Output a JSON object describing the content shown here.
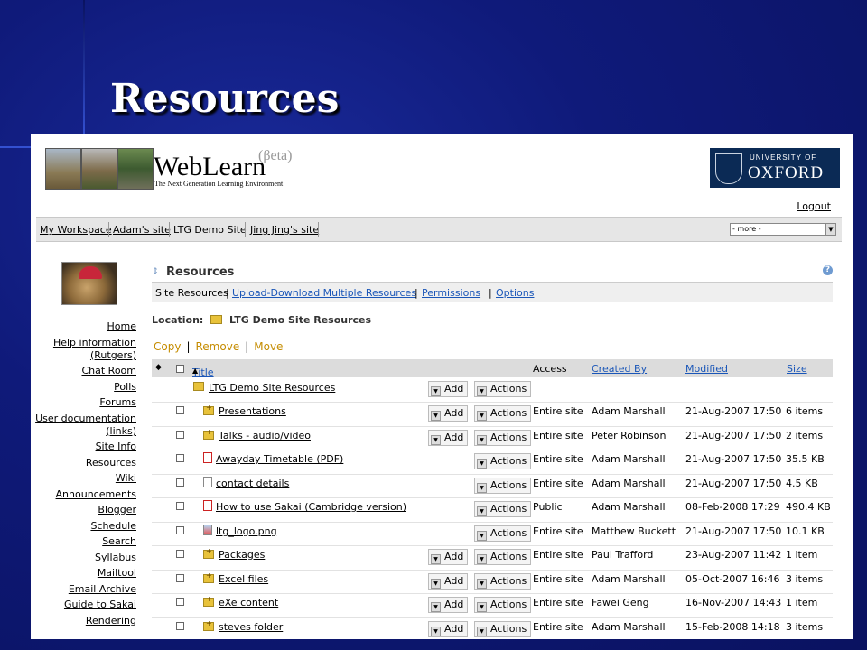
{
  "slide": {
    "title": "Resources"
  },
  "header": {
    "brand_name": "WebLearn",
    "brand_beta": "(βeta)",
    "brand_tagline": "The Next Generation Learning Environment",
    "university_line1": "UNIVERSITY OF",
    "university_line2": "OXFORD",
    "logout": "Logout"
  },
  "nav": {
    "sites": [
      "My Workspace",
      "Adam's site",
      "LTG Demo Site",
      "Jing Jing's site"
    ],
    "more": "- more -"
  },
  "left_menu": [
    "Home",
    "Help information (Rutgers)",
    "Chat Room",
    "Polls",
    "Forums",
    "User documentation (links)",
    "Site Info",
    "Resources",
    "Wiki",
    "Announcements",
    "Blogger",
    "Schedule",
    "Search",
    "Syllabus",
    "Mailtool",
    "Email Archive",
    "Guide to Sakai",
    "Rendering"
  ],
  "tool": {
    "title": "Resources",
    "help": "?",
    "toolbar": {
      "current": "Site Resources",
      "upload": "Upload-Download Multiple Resources",
      "permissions": "Permissions",
      "options": "Options"
    },
    "location_label": "Location:",
    "location_value": "LTG Demo Site Resources",
    "actions": {
      "copy": "Copy",
      "remove": "Remove",
      "move": "Move"
    }
  },
  "table": {
    "columns": {
      "title": "Title",
      "access": "Access",
      "created_by": "Created By",
      "modified": "Modified",
      "size": "Size"
    },
    "sort_indicator": "▲",
    "add_label": "Add",
    "actions_label": "Actions",
    "root": {
      "title": "LTG Demo Site Resources"
    },
    "rows": [
      {
        "title": "Presentations",
        "type": "folder",
        "access": "Entire site",
        "created_by": "Adam Marshall",
        "modified": "21-Aug-2007 17:50",
        "size": "6 items"
      },
      {
        "title": "Talks - audio/video",
        "type": "folder",
        "access": "Entire site",
        "created_by": "Peter Robinson",
        "modified": "21-Aug-2007 17:50",
        "size": "2 items"
      },
      {
        "title": "Awayday Timetable (PDF)",
        "type": "pdf",
        "access": "Entire site",
        "created_by": "Adam Marshall",
        "modified": "21-Aug-2007 17:50",
        "size": "35.5 KB"
      },
      {
        "title": "contact details",
        "type": "doc",
        "access": "Entire site",
        "created_by": "Adam Marshall",
        "modified": "21-Aug-2007 17:50",
        "size": "4.5 KB"
      },
      {
        "title": "How to use Sakai (Cambridge version)",
        "type": "pdf",
        "access": "Public",
        "created_by": "Adam Marshall",
        "modified": "08-Feb-2008 17:29",
        "size": "490.4 KB"
      },
      {
        "title": "ltg_logo.png",
        "type": "img",
        "access": "Entire site",
        "created_by": "Matthew Buckett",
        "modified": "21-Aug-2007 17:50",
        "size": "10.1 KB"
      },
      {
        "title": "Packages",
        "type": "folder",
        "access": "Entire site",
        "created_by": "Paul Trafford",
        "modified": "23-Aug-2007 11:42",
        "size": "1 item"
      },
      {
        "title": "Excel files",
        "type": "folder",
        "access": "Entire site",
        "created_by": "Adam Marshall",
        "modified": "05-Oct-2007 16:46",
        "size": "3 items"
      },
      {
        "title": "eXe content",
        "type": "folder",
        "access": "Entire site",
        "created_by": "Fawei Geng",
        "modified": "16-Nov-2007 14:43",
        "size": "1 item"
      },
      {
        "title": "steves folder",
        "type": "folder",
        "access": "Entire site",
        "created_by": "Adam Marshall",
        "modified": "15-Feb-2008 14:18",
        "size": "3 items"
      }
    ]
  }
}
